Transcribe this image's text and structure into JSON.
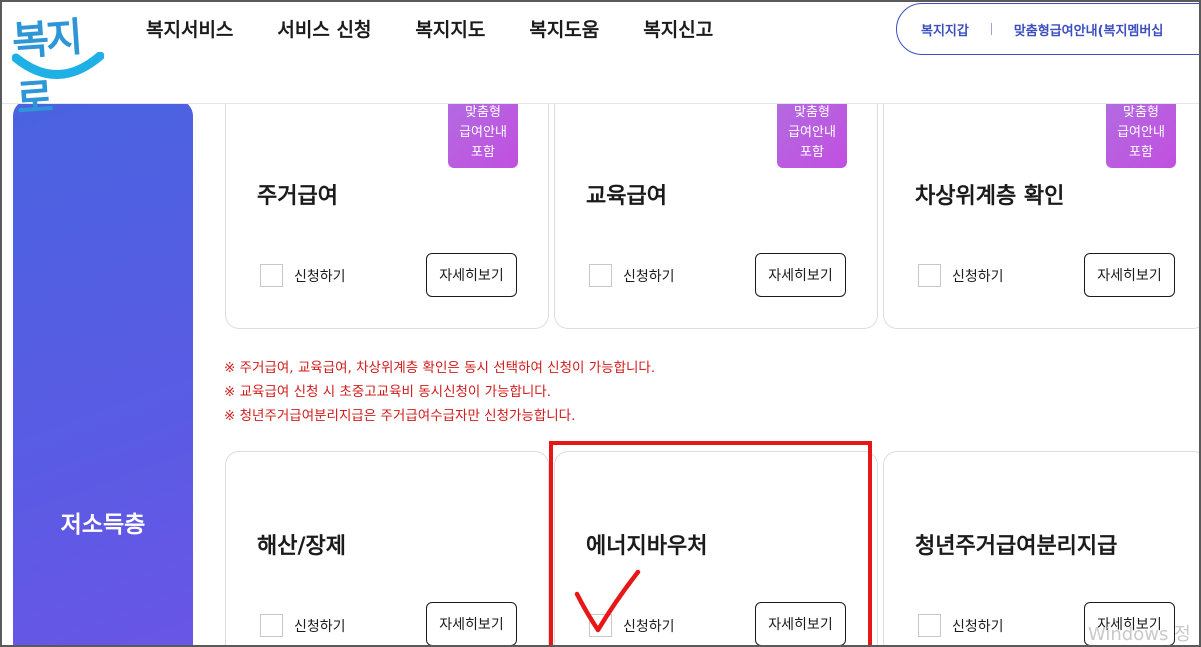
{
  "logo": {
    "text": "복지로"
  },
  "nav": [
    "복지서비스",
    "서비스 신청",
    "복지지도",
    "복지도움",
    "복지신고"
  ],
  "util_links": [
    "복지지갑",
    "맞춤형급여안내(복지멤버십"
  ],
  "sidebar": {
    "label": "저소득층"
  },
  "badge": {
    "line1": "맞춤형",
    "line2": "급여안내",
    "line3": "포함"
  },
  "cards_row1": [
    {
      "title": "주거급여",
      "apply_label": "신청하기",
      "detail_label": "자세히보기",
      "badge": true
    },
    {
      "title": "교육급여",
      "apply_label": "신청하기",
      "detail_label": "자세히보기",
      "badge": true
    },
    {
      "title": "차상위계층 확인",
      "apply_label": "신청하기",
      "detail_label": "자세히보기",
      "badge": true
    }
  ],
  "notices": [
    "※ 주거급여, 교육급여, 차상위계층 확인은 동시 선택하여 신청이 가능합니다.",
    "※ 교육급여 신청 시 초중고교육비 동시신청이 가능합니다.",
    "※ 청년주거급여분리지급은 주거급여수급자만 신청가능합니다."
  ],
  "cards_row2": [
    {
      "title": "해산/장제",
      "apply_label": "신청하기",
      "detail_label": "자세히보기"
    },
    {
      "title": "에너지바우처",
      "apply_label": "신청하기",
      "detail_label": "자세히보기"
    },
    {
      "title": "청년주거급여분리지급",
      "apply_label": "신청하기",
      "detail_label": "자세히보기"
    }
  ],
  "watermark": "Windows 정",
  "colors": {
    "brand_blue": "#3c4fbf",
    "sidebar_gradient_start": "#4a63e0",
    "sidebar_gradient_end": "#6a55e6",
    "badge_purple": "#c24fe0",
    "notice_red": "#d21b1b",
    "annotation_red": "#e81717"
  }
}
